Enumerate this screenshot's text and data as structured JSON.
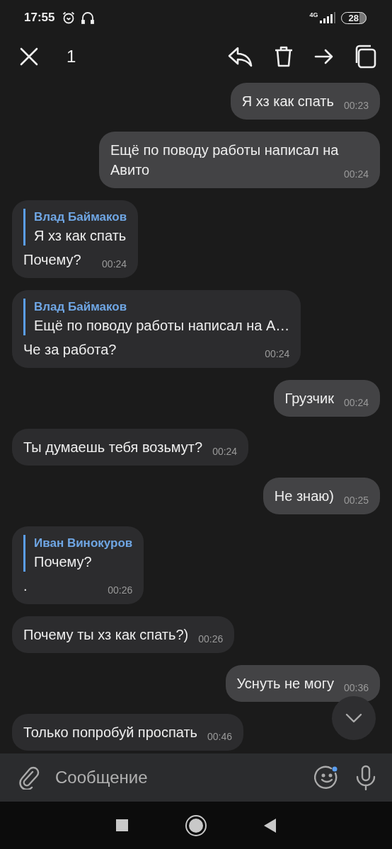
{
  "status_bar": {
    "time": "17:55",
    "network": "4G",
    "battery": "28"
  },
  "selection_bar": {
    "count": "1"
  },
  "messages": [
    {
      "kind": "outgoing",
      "text": "Я хз как спать",
      "time": "00:23"
    },
    {
      "kind": "outgoing",
      "text": "Ещё по поводу работы написал на Авито",
      "time": "00:24"
    },
    {
      "kind": "incoming",
      "reply": {
        "author": "Влад Баймаков",
        "text": "Я хз как спать"
      },
      "text": "Почему?",
      "time": "00:24"
    },
    {
      "kind": "incoming",
      "reply": {
        "author": "Влад Баймаков",
        "text": "Ещё по поводу работы написал на А…"
      },
      "text": "Че за работа?",
      "time": "00:24"
    },
    {
      "kind": "outgoing",
      "text": "Грузчик",
      "time": "00:24"
    },
    {
      "kind": "incoming",
      "text": "Ты думаешь тебя возьмут?",
      "time": "00:24"
    },
    {
      "kind": "outgoing",
      "text": "Не знаю)",
      "time": "00:25"
    },
    {
      "kind": "incoming",
      "reply": {
        "author": "Иван Винокуров",
        "text": "Почему?"
      },
      "text": ".",
      "time": "00:26"
    },
    {
      "kind": "incoming",
      "text": "Почему ты хз как спать?)",
      "time": "00:26"
    },
    {
      "kind": "outgoing",
      "text": "Уснуть не могу",
      "time": "00:36"
    },
    {
      "kind": "incoming",
      "text": "Только попробуй проспать",
      "time": "00:46"
    }
  ],
  "composer": {
    "placeholder": "Сообщение"
  }
}
